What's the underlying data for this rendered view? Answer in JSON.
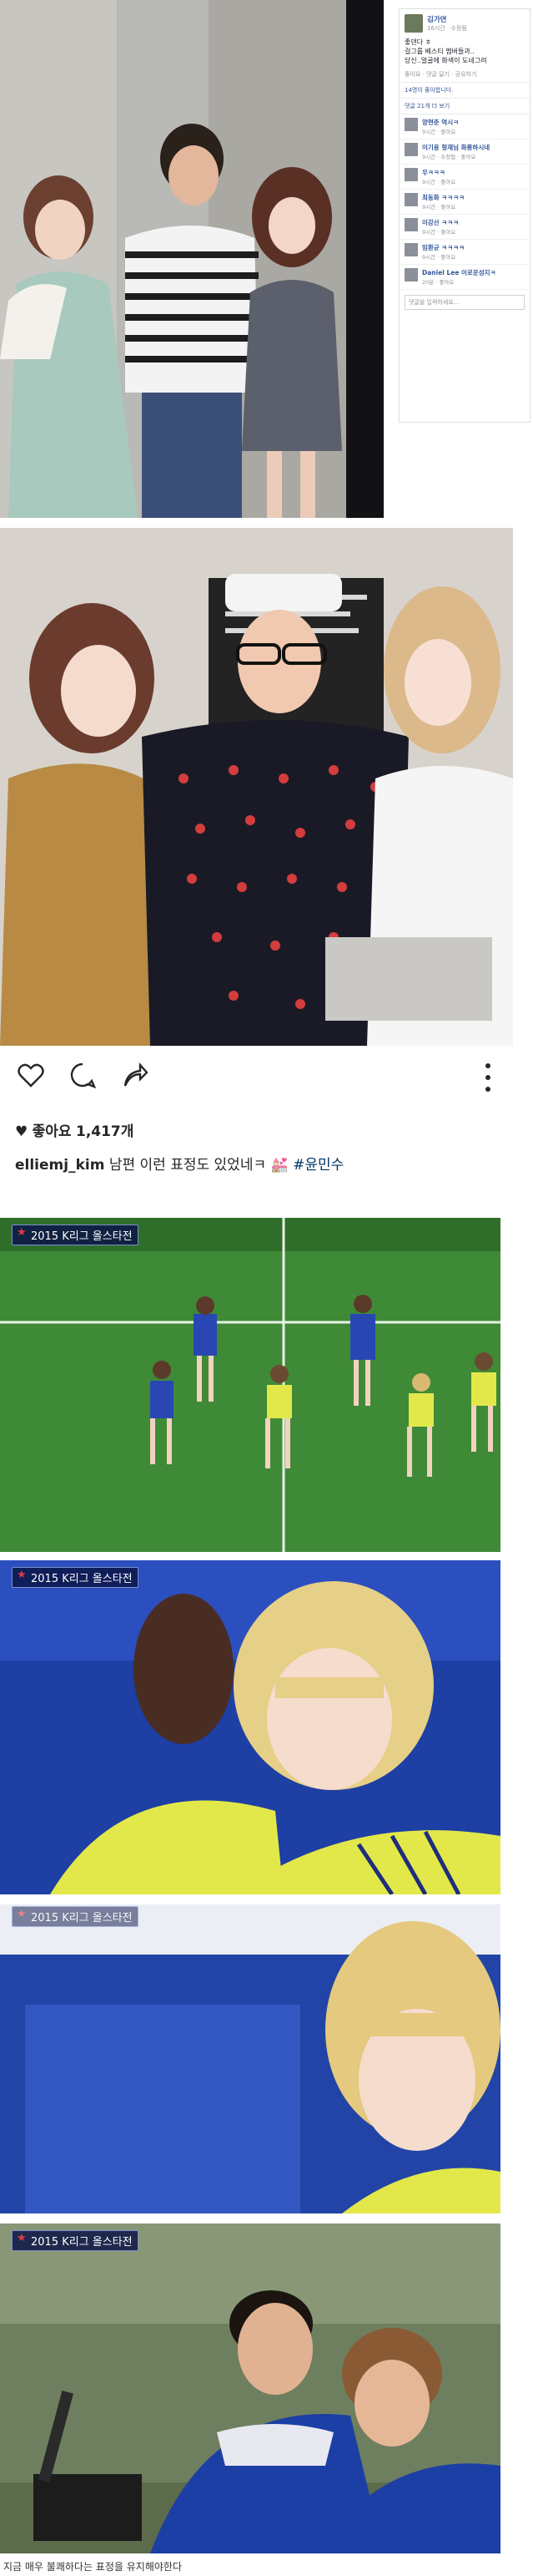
{
  "facebook": {
    "name": "김가연",
    "time": "16시간 · 수정됨",
    "body_lines": [
      "좋댄다 ㅎ",
      "걸그룹 베스티 멤버들과..",
      "당신..얼굴에 화색이 도네그려"
    ],
    "actions": "좋아요 · 댓글 달기 · 공유하기",
    "likes": "14명이 좋아합니다.",
    "more_comments": "댓글 21개 더 보기",
    "comments": [
      {
        "name": "양현준 역시ㅋ",
        "meta": "9시간 · 좋아요"
      },
      {
        "name": "이기용 형재님 화룡하시네",
        "meta": "9시간 · 수정됨 · 좋아요"
      },
      {
        "name": "우ㅋㅋㅋ",
        "meta": "9시간 · 좋아요"
      },
      {
        "name": "최동화 ㅋㅋㅋㅋ",
        "meta": "9시간 · 좋아요"
      },
      {
        "name": "이강산 ㅋㅋㅋ",
        "meta": "9시간 · 좋아요"
      },
      {
        "name": "임환균 ㅋㅋㅋㅋ",
        "meta": "9시간 · 좋아요"
      },
      {
        "name": "Daniel Lee 이로운성지ㅋ",
        "meta": "20분 · 좋아요"
      }
    ],
    "input_placeholder": "댓글을 입력하세요..."
  },
  "instagram": {
    "likes_prefix": "좋아요",
    "likes_count": "1,417개",
    "username": "elliemj_kim",
    "caption": "남편 이런 표정도 있었네ㅋ",
    "hashtag": "#윤민수",
    "icons": [
      "heart-icon",
      "comment-icon",
      "share-icon",
      "more-dots-icon"
    ]
  },
  "broadcast": {
    "logo_text": "2015 K리그 올스타전"
  },
  "bottom_caption": "지금 매우 불쾌하다는 표정을 유지해야한다",
  "colors": {
    "facebook_blue": "#365899",
    "instagram_link": "#003569",
    "field_green": "#3f8a37",
    "jersey_blue": "#1c3fa5",
    "jersey_yellow": "#e3e84a"
  }
}
